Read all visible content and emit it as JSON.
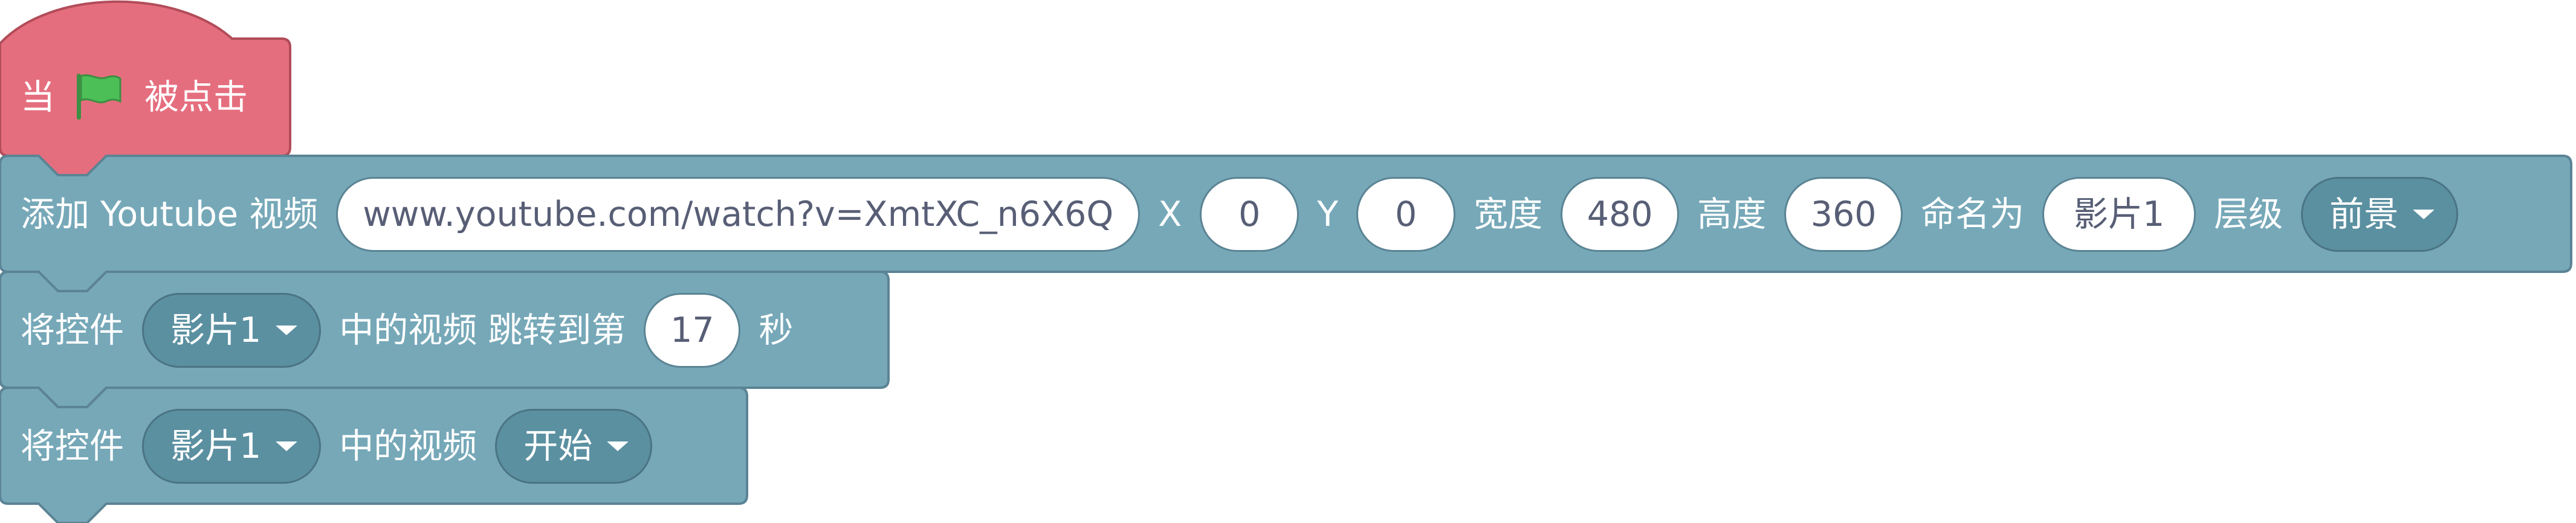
{
  "colors": {
    "event_fill": "#e56e7e",
    "event_stroke": "#b24c59",
    "block_fill": "#76a8b8",
    "block_stroke": "#5b8494",
    "dropdown_fill": "#5b90a1",
    "flag_green": "#4cbf56"
  },
  "hat": {
    "prefix": "当",
    "flag_icon": "green-flag-icon",
    "suffix": "被点击"
  },
  "add_video": {
    "label": "添加 Youtube 视频",
    "url": "www.youtube.com/watch?v=XmtXC_n6X6Q",
    "x_label": "X",
    "x_value": "0",
    "y_label": "Y",
    "y_value": "0",
    "width_label": "宽度",
    "width_value": "480",
    "height_label": "高度",
    "height_value": "360",
    "name_label": "命名为",
    "name_value": "影片1",
    "layer_label": "层级",
    "layer_value": "前景"
  },
  "seek": {
    "prefix": "将控件",
    "control": "影片1",
    "middle": "中的视频 跳转到第",
    "seconds": "17",
    "suffix": "秒"
  },
  "play": {
    "prefix": "将控件",
    "control": "影片1",
    "middle": "中的视频",
    "action": "开始"
  }
}
